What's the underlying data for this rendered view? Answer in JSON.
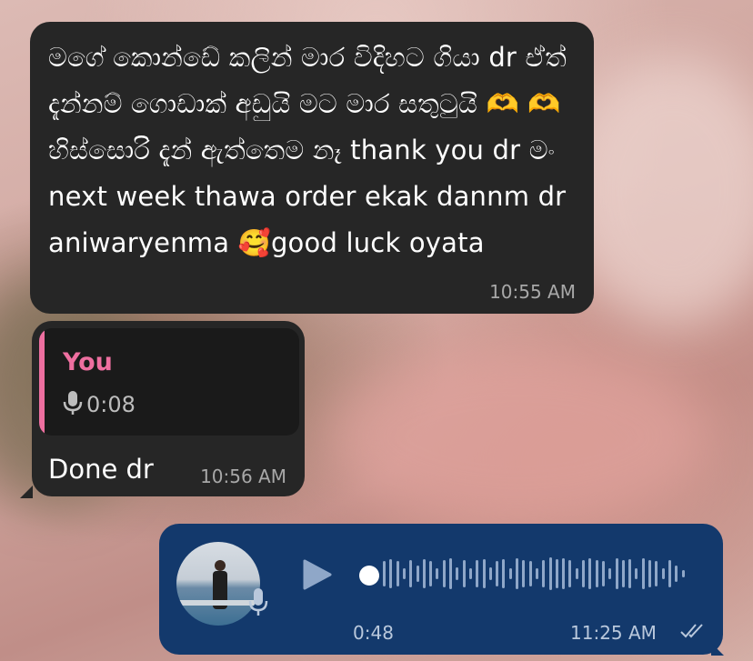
{
  "messages": {
    "incoming_1": {
      "text": "මගේ කොන්ඩේ කලින් මාර විදිහට ගියා dr ඒත් දැන්නම් ගොඩාක් අඩුයි මට මාර සතුටුයි 🫶 🫶 හිස්සොරි දැන් ඇත්තෙම නෑ thank you dr මං next week thawa order ekak dannm dr aniwaryenma 🥰good luck oyata",
      "time": "10:55 AM"
    },
    "incoming_2": {
      "reply_to_name": "You",
      "reply_to_duration": "0:08",
      "text": "Done dr",
      "time": "10:56 AM"
    },
    "outgoing_1": {
      "voice_duration": "0:48",
      "time": "11:25 AM",
      "status": "read",
      "playback_progress": 0
    }
  },
  "icons": {
    "mic": "microphone-icon",
    "play": "play-icon",
    "read": "double-check-icon"
  },
  "colors": {
    "incoming_bubble": "#262626",
    "outgoing_bubble": "#13396c",
    "reply_accent": "#ee6fa0"
  }
}
